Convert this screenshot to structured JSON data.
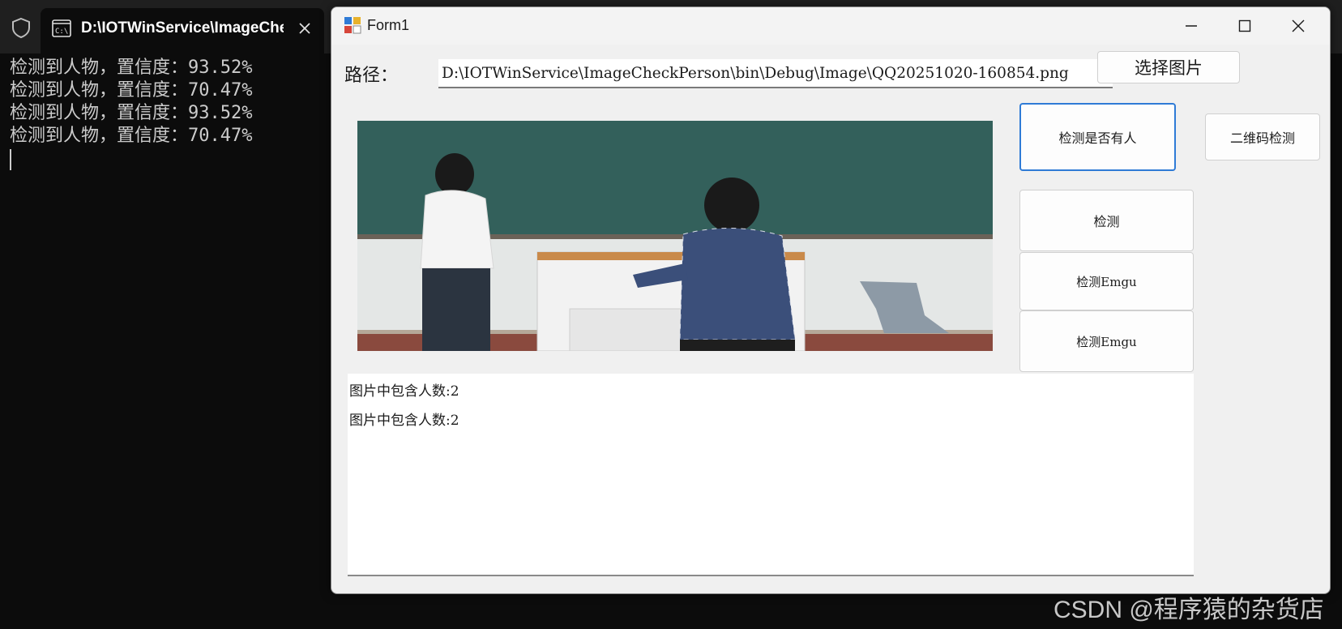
{
  "terminal": {
    "tab_title": "D:\\IOTWinService\\ImageChecl",
    "lines": [
      "检测到人物，置信度：93.52%",
      "检测到人物，置信度：70.47%",
      "检测到人物，置信度：93.52%",
      "检测到人物，置信度：70.47%"
    ]
  },
  "form": {
    "title": "Form1",
    "path_label": "路径：",
    "path_value": "D:\\IOTWinService\\ImageCheckPerson\\bin\\Debug\\Image\\QQ20251020-160854.png",
    "buttons": {
      "choose_image": "选择图片",
      "detect_person": "检测是否有人",
      "qrcode_detect": "二维码检测",
      "detect": "检测",
      "detect_emgu_1": "检测Emgu",
      "detect_emgu_2": "检测Emgu"
    },
    "log_lines": [
      "图片中包含人数:2",
      "图片中包含人数:2"
    ]
  },
  "watermark": "CSDN @程序猿的杂货店",
  "icons": {
    "terminal_shield": "shield-icon",
    "terminal_tab": "terminal-icon",
    "tab_close": "close-icon",
    "app": "form-app-icon",
    "minimize": "minimize-icon",
    "maximize": "maximize-icon",
    "close": "close-icon"
  },
  "colors": {
    "terminal_bg": "#0c0c0c",
    "form_bg": "#f0f0f0",
    "focus_border": "#2f7bd6"
  }
}
